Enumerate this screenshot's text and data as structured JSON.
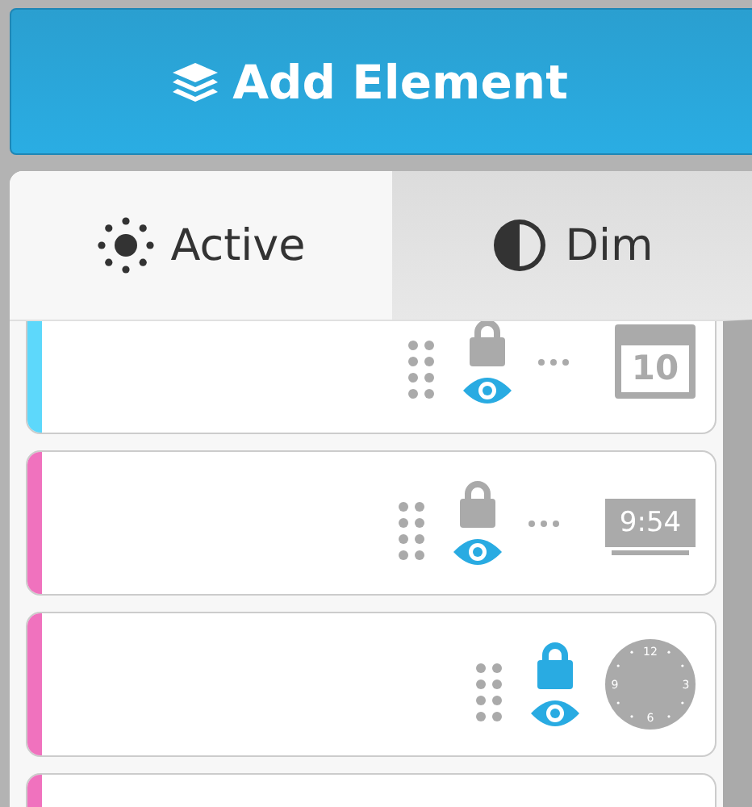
{
  "add_button": {
    "label": "Add Element"
  },
  "tabs": [
    {
      "label": "Active",
      "kind": "active",
      "selected": true
    },
    {
      "label": "Dim",
      "kind": "dim",
      "selected": false
    }
  ],
  "elements": [
    {
      "color": "#5dd8fb",
      "locked": false,
      "visible": true,
      "menu": true,
      "widget": {
        "kind": "calendar",
        "text": "10"
      }
    },
    {
      "color": "#f072be",
      "locked": false,
      "visible": true,
      "menu": true,
      "widget": {
        "kind": "digital",
        "text": "9:54"
      }
    },
    {
      "color": "#f072be",
      "locked": true,
      "visible": true,
      "menu": false,
      "widget": {
        "kind": "analog",
        "labels": [
          "12",
          "3",
          "6",
          "9"
        ]
      }
    },
    {
      "color": "#f072be"
    }
  ]
}
